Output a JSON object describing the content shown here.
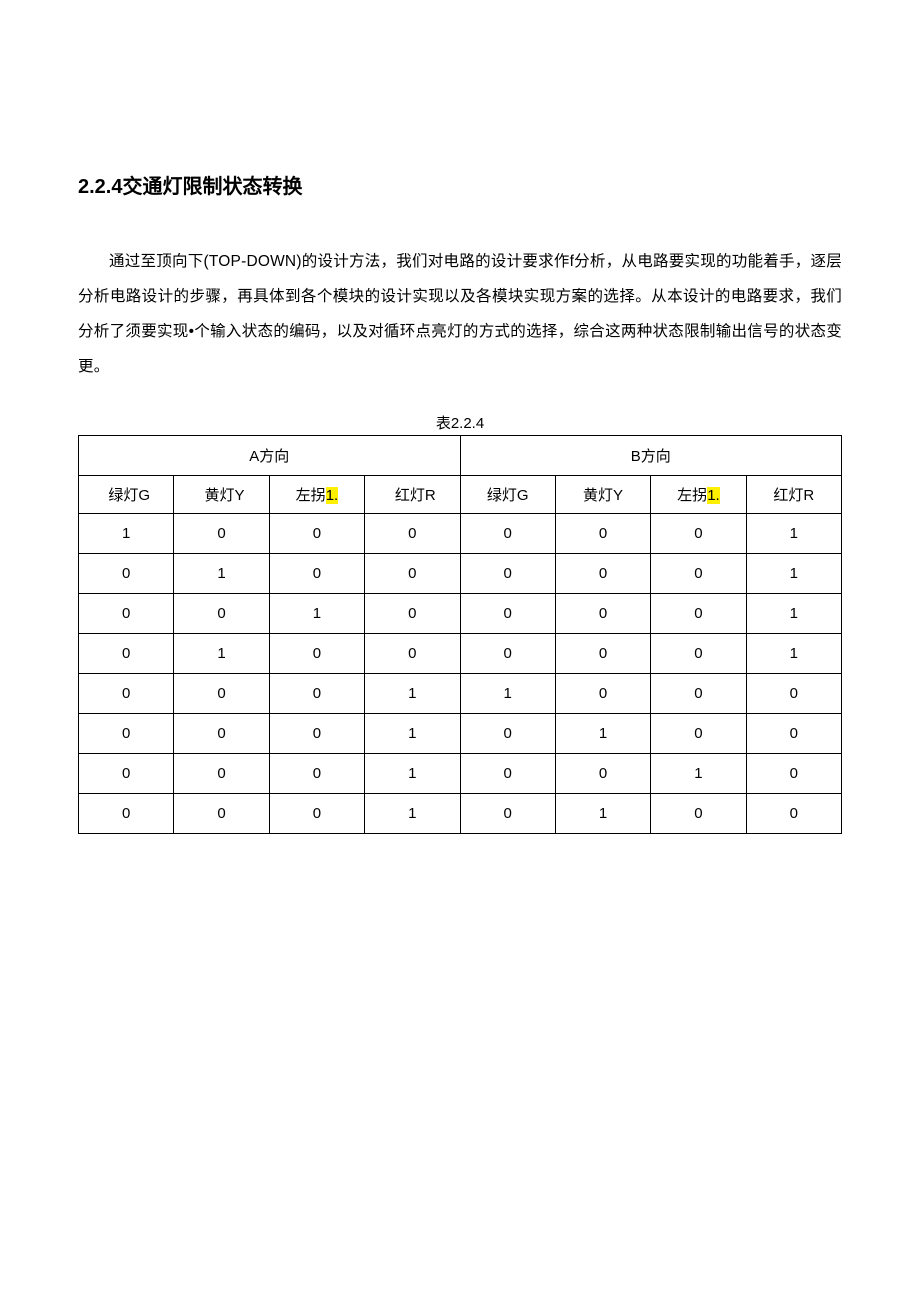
{
  "heading": "2.2.4交通灯限制状态转换",
  "paragraph": "通过至顶向下(TOP-DOWN)的设计方法，我们对电路的设计要求作f分析，从电路要实现的功能着手，逐层分析电路设计的步骤，再具体到各个模块的设计实现以及各模块实现方案的选择。从本设计的电路要求，我们分析了须要实现•个输入状态的编码，以及对循环点亮灯的方式的选择，综合这两种状态限制输出信号的状态变更。",
  "table": {
    "caption": "表2.2.4",
    "direction_headers": [
      "A方向",
      "B方向"
    ],
    "sub_headers": {
      "a": {
        "g": "绿灯G",
        "y": "黄灯Y",
        "l_pre": "左拐",
        "l_hl": "1.",
        "r": "红灯R"
      },
      "b": {
        "g": "绿灯G",
        "y": "黄灯Y",
        "l_pre": "左拐",
        "l_hl": "1.",
        "r": "红灯R"
      }
    },
    "rows": [
      [
        "1",
        "0",
        "0",
        "0",
        "0",
        "0",
        "0",
        "1"
      ],
      [
        "0",
        "1",
        "0",
        "0",
        "0",
        "0",
        "0",
        "1"
      ],
      [
        "0",
        "0",
        "1",
        "0",
        "0",
        "0",
        "0",
        "1"
      ],
      [
        "0",
        "1",
        "0",
        "0",
        "0",
        "0",
        "0",
        "1"
      ],
      [
        "0",
        "0",
        "0",
        "1",
        "1",
        "0",
        "0",
        "0"
      ],
      [
        "0",
        "0",
        "0",
        "1",
        "0",
        "1",
        "0",
        "0"
      ],
      [
        "0",
        "0",
        "0",
        "1",
        "0",
        "0",
        "1",
        "0"
      ],
      [
        "0",
        "0",
        "0",
        "1",
        "0",
        "1",
        "0",
        "0"
      ]
    ]
  }
}
